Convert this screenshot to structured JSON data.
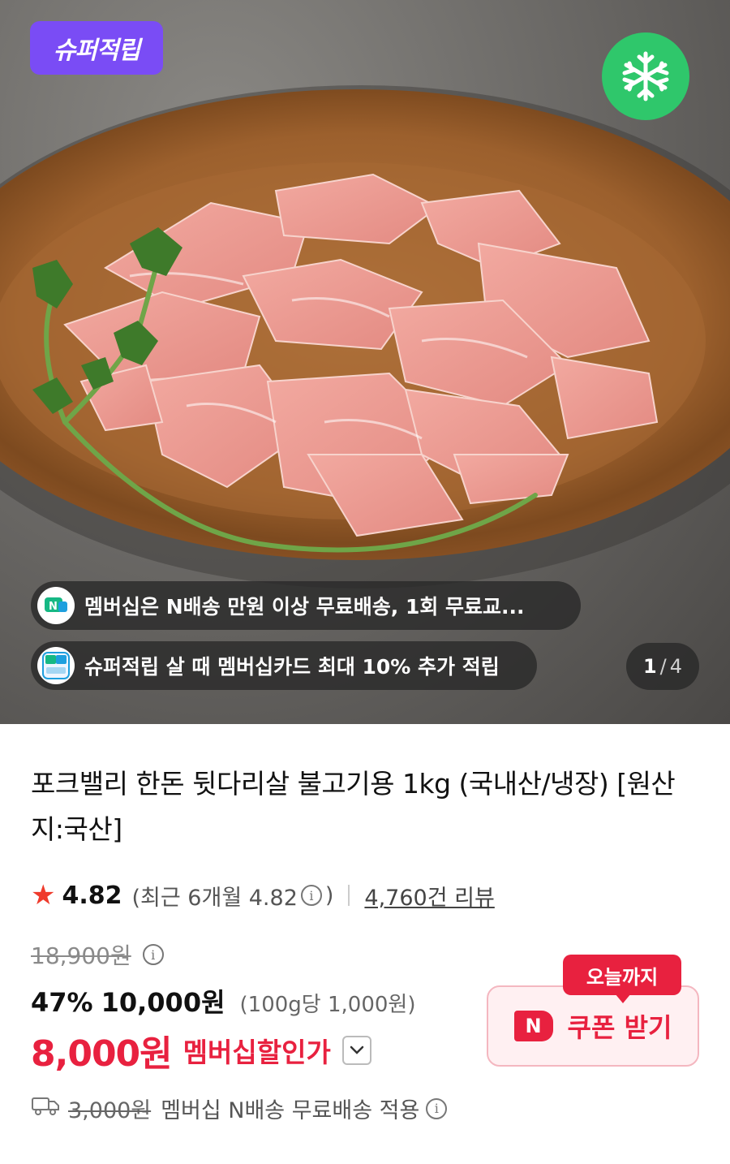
{
  "hero": {
    "super_badge": "슈퍼적립",
    "pill1_text": "멤버십은 N배송 만원 이상 무료배송, 1회 무료교...",
    "pill2_text": "슈퍼적립 살 때 멤버십카드 최대 10% 추가 적립",
    "pager_current": "1",
    "pager_sep": "/",
    "pager_total": "4",
    "icons": [
      "snowflake-icon",
      "delivery-truck-icon",
      "nplus-membership-icon"
    ]
  },
  "product": {
    "title": "포크밸리 한돈 뒷다리살 불고기용 1kg (국내산/냉장) [원산지:국산]",
    "rating": "4.82",
    "recent_prefix": "(최근 6개월 4.82",
    "recent_suffix": ")",
    "review_count": "4,760건 리뷰",
    "original_price": "18,900원",
    "discount_rate": "47%",
    "sale_price": "10,000원",
    "unit_price": "(100g당 1,000원)",
    "member_price": "8,000원",
    "member_label": "멤버십할인가",
    "coupon_badge": "오늘까지",
    "coupon_n": "N",
    "coupon_label": "쿠폰 받기",
    "shipping_old": "3,000원",
    "shipping_text": "멤버십 N배송 무료배송 적용"
  },
  "colors": {
    "accent_red": "#e8213f",
    "super_purple": "#7a4cf5",
    "frozen_green": "#2fc76b",
    "star": "#ef3b2c"
  }
}
